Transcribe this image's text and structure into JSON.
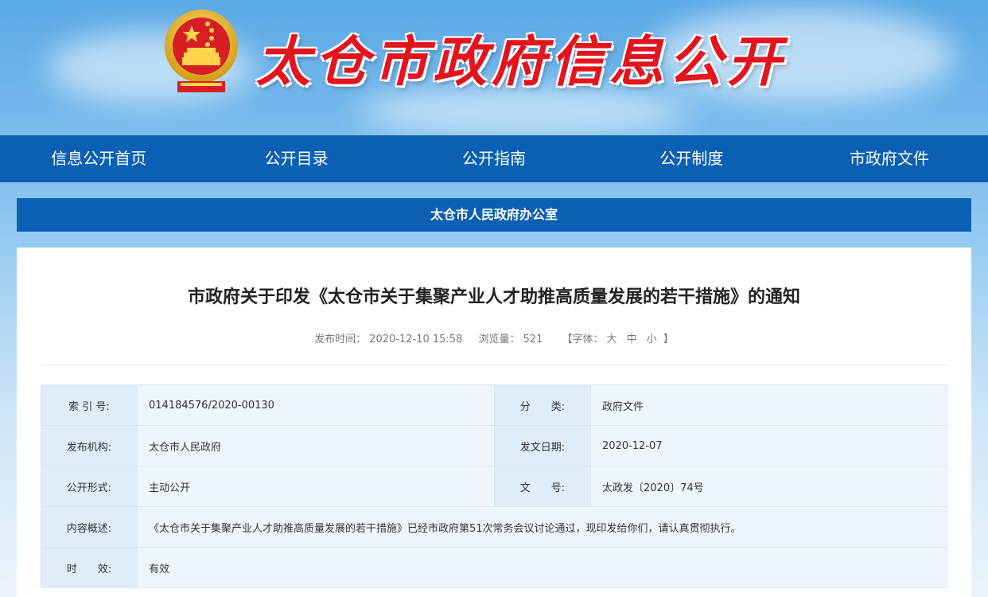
{
  "site": {
    "title": "太仓市政府信息公开"
  },
  "nav": [
    {
      "label": "信息公开首页"
    },
    {
      "label": "公开目录"
    },
    {
      "label": "公开指南"
    },
    {
      "label": "公开制度"
    },
    {
      "label": "市政府文件"
    }
  ],
  "office": {
    "name": "太仓市人民政府办公室"
  },
  "doc": {
    "title": "市政府关于印发《太仓市关于集聚产业人才助推高质量发展的若干措施》的通知",
    "publish_label": "发布时间：",
    "publish_time": "2020-12-10 15:58",
    "views_label": "浏览量：",
    "views": "521",
    "font_open": "【字体：",
    "font_large": "大",
    "font_medium": "中",
    "font_small": "小",
    "font_close": "】"
  },
  "info": {
    "index_label": "索 引 号:",
    "index_value": "014184576/2020-00130",
    "category_label": "分　　类:",
    "category_value": "政府文件",
    "org_label": "发布机构:",
    "org_value": "太仓市人民政府",
    "date_label": "发文日期:",
    "date_value": "2020-12-07",
    "form_label": "公开形式:",
    "form_value": "主动公开",
    "number_label": "文　　号:",
    "number_value": "太政发〔2020〕74号",
    "summary_label": "内容概述:",
    "summary_value": "《太仓市关于集聚产业人才助推高质量发展的若干措施》已经市政府第51次常务会议讨论通过，现印发给你们，请认真贯彻执行。",
    "validity_label": "时　　效:",
    "validity_value": "有效"
  },
  "colors": {
    "nav": "#0b5fb5",
    "title_red": "#e3141e"
  }
}
